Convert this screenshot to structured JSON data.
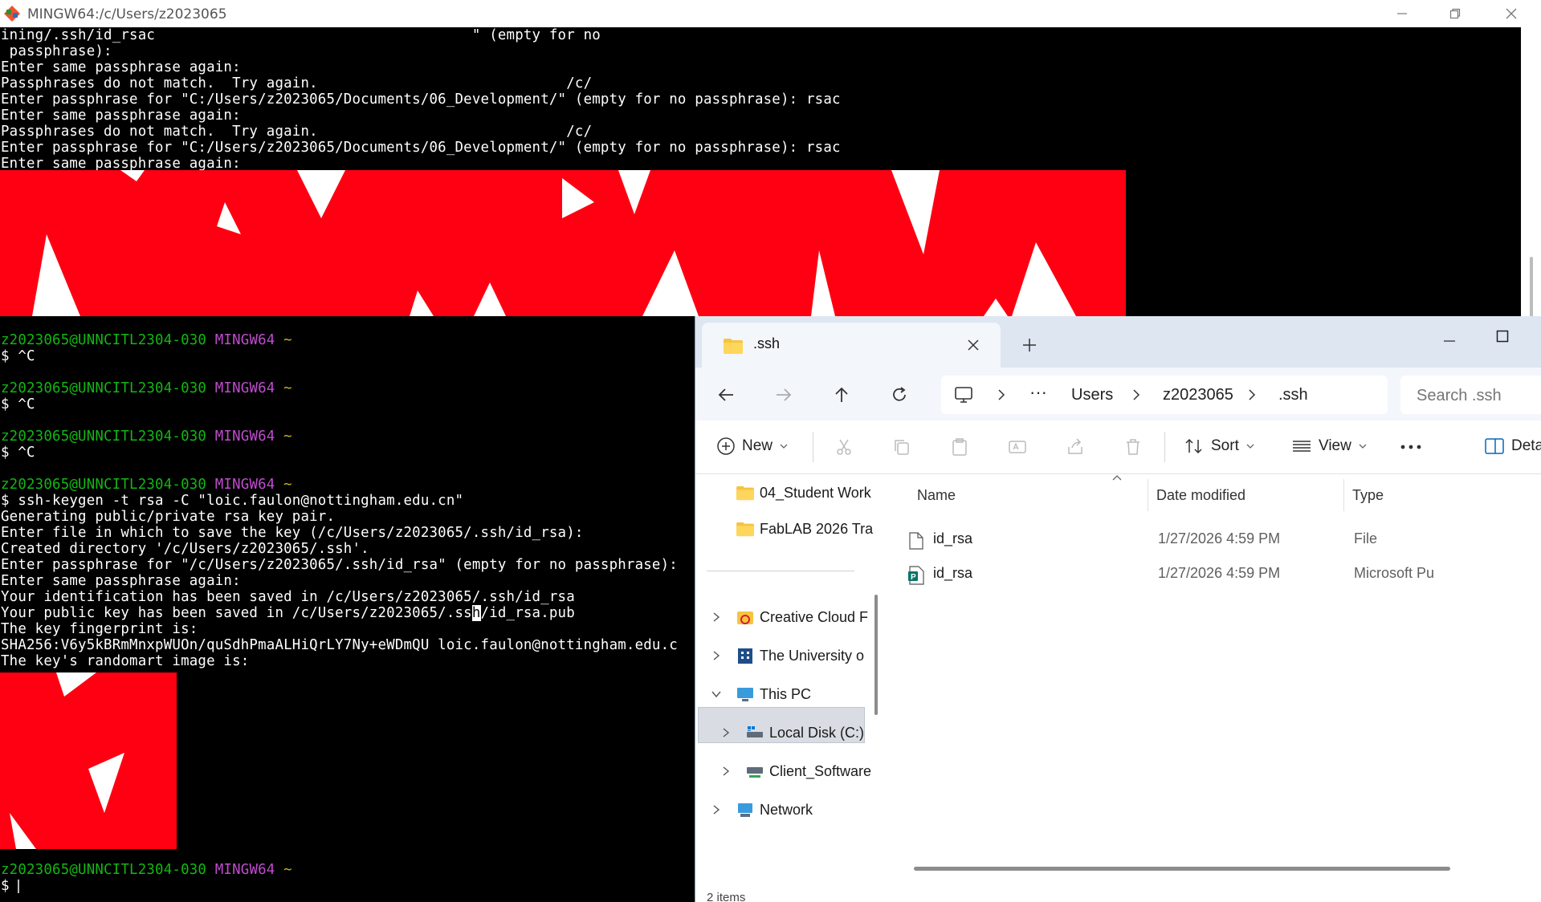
{
  "terminal": {
    "title": "MINGW64:/c/Users/z2023065",
    "top_lines": [
      "ining/.ssh/id_rsac                                     \" (empty for no",
      " passphrase):",
      "Enter same passphrase again:",
      "Passphrases do not match.  Try again.                             /c/",
      "Enter passphrase for \"C:/Users/z2023065/Documents/06_Development/\" (empty for no passphrase): rsac",
      "Enter same passphrase again:",
      "Passphrases do not match.  Try again.                             /c/",
      "Enter passphrase for \"C:/Users/z2023065/Documents/06_Development/\" (empty for no passphrase): rsac",
      "Enter same passphrase again:"
    ],
    "prompt_user": "z2023065@UNNCITL2304-030",
    "prompt_env": "MINGW64",
    "prompt_path": "~",
    "ctrl_c": "$ ^C",
    "keygen_command": "$ ssh-keygen -t rsa -C \"loic.faulon@nottingham.edu.cn\"",
    "keygen_output": [
      "Generating public/private rsa key pair.",
      "Enter file in which to save the key (/c/Users/z2023065/.ssh/id_rsa):",
      "Created directory '/c/Users/z2023065/.ssh'.",
      "Enter passphrase for \"/c/Users/z2023065/.ssh/id_rsa\" (empty for no passphrase):",
      "Enter same passphrase again:",
      "Your identification has been saved in /c/Users/z2023065/.ssh/id_rsa"
    ],
    "pub_line_a": "Your public key has been saved in /c/Users/z2023065/.ss",
    "pub_line_cursor": "h",
    "pub_line_b": "/id_rsa.pub",
    "keygen_output_2": [
      "The key fingerprint is:",
      "SHA256:V6y5kBRmMnxpWUOn/quSdhPmaALHiQrLY7Ny+eWDmQU loic.faulon@nottingham.edu.c",
      "The key's randomart image is:"
    ],
    "last_prompt": "$ "
  },
  "explorer": {
    "tab_title": ".ssh",
    "breadcrumbs": [
      "Users",
      "z2023065",
      ".ssh"
    ],
    "search_placeholder": "Search .ssh",
    "toolbar": {
      "new": "New",
      "sort": "Sort",
      "view": "View",
      "details": "Deta"
    },
    "nav_pane": [
      {
        "label": "04_Student Work"
      },
      {
        "label": "FabLAB 2026 Tra"
      },
      {
        "label": "Creative Cloud F"
      },
      {
        "label": "The University o"
      },
      {
        "label": "This PC"
      },
      {
        "label": "Local Disk (C:)"
      },
      {
        "label": "Client_Software"
      },
      {
        "label": "Network"
      }
    ],
    "columns": {
      "name": "Name",
      "date": "Date modified",
      "type": "Type"
    },
    "files": [
      {
        "name": "id_rsa",
        "date": "1/27/2026 4:59 PM",
        "type": "File",
        "icon": "blank-file-icon"
      },
      {
        "name": "id_rsa",
        "date": "1/27/2026 4:59 PM",
        "type": "Microsoft Pu",
        "icon": "publisher-file-icon"
      }
    ],
    "status": "2 items",
    "colors": {
      "accent": "#0067c0",
      "folder": "#f5c440",
      "terminal_bg": "#000000",
      "art_red": "#ff0012"
    }
  }
}
